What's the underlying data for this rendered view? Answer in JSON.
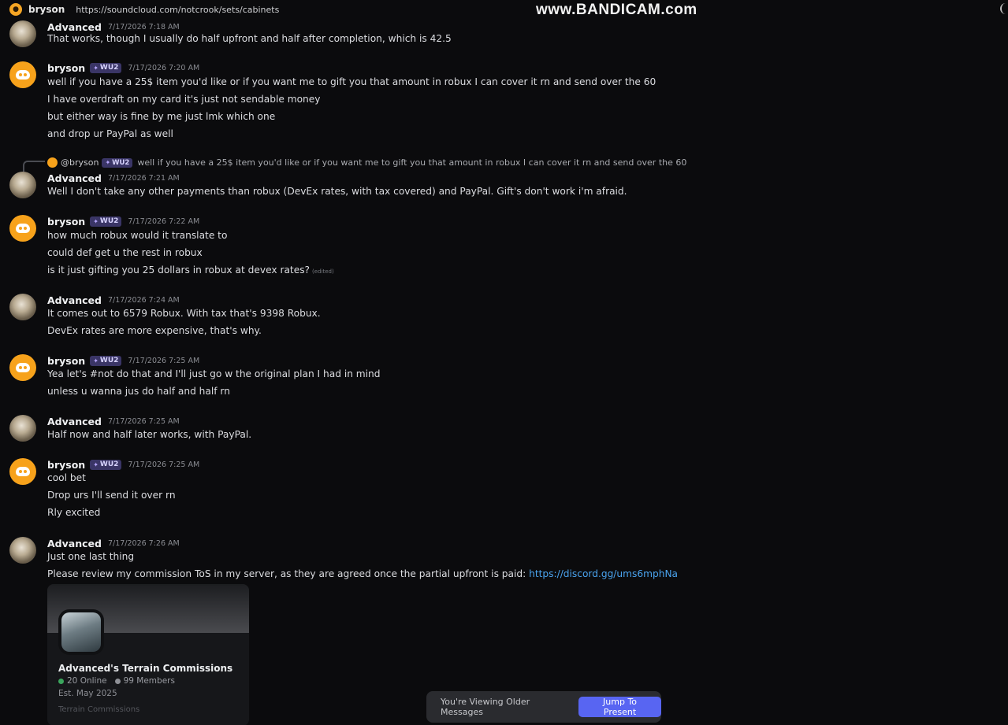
{
  "topbar": {
    "user": "bryson",
    "url": "https://soundcloud.com/notcrook/sets/cabinets",
    "watermark": "www.BANDICAM.com"
  },
  "messages": [
    {
      "author": "Advanced",
      "time": "7/17/2026 7:18 AM",
      "badge": "",
      "lines": [
        "That works, though I usually do half upfront and half after completion, which is 42.5"
      ]
    },
    {
      "author": "bryson",
      "time": "7/17/2026 7:20 AM",
      "badge": "WU2",
      "lines": [
        "well if you have a 25$ item you'd like or if you want me to gift you that amount in robux I can cover it rn and send over the 60",
        "I have overdraft on my card it's just not sendable money",
        "but either way is fine by me just lmk which one",
        "and drop ur PayPal as well"
      ]
    },
    {
      "author": "Advanced",
      "time": "7/17/2026 7:21 AM",
      "badge": "",
      "lines": [
        "Well I don't take any other payments than robux (DevEx rates, with tax covered) and PayPal. Gift's don't work i'm afraid."
      ]
    },
    {
      "author": "bryson",
      "time": "7/17/2026 7:22 AM",
      "badge": "WU2",
      "lines": [
        "how much robux would it translate to",
        "could def get u the rest in robux",
        "is it just gifting you 25 dollars in robux at devex rates?"
      ],
      "edited": "(edited)"
    },
    {
      "author": "Advanced",
      "time": "7/17/2026 7:24 AM",
      "badge": "",
      "lines": [
        "It comes out to 6579 Robux. With tax that's 9398 Robux.",
        "DevEx rates are more expensive, that's why."
      ]
    },
    {
      "author": "bryson",
      "time": "7/17/2026 7:25 AM",
      "badge": "WU2",
      "lines": [
        "Yea let's #not do that and I'll just go w the original plan I had in mind",
        "unless u wanna jus do half and half rn"
      ]
    },
    {
      "author": "Advanced",
      "time": "7/17/2026 7:25 AM",
      "badge": "",
      "lines": [
        "Half now and half later works, with PayPal."
      ]
    },
    {
      "author": "bryson",
      "time": "7/17/2026 7:25 AM",
      "badge": "WU2",
      "lines": [
        "cool bet",
        "Drop urs I'll send it over rn",
        "Rly excited"
      ]
    },
    {
      "author": "Advanced",
      "time": "7/17/2026 7:26 AM",
      "badge": "",
      "lines": [
        "Just one last thing",
        "Please review my commission ToS in my server, as they are agreed once the partial upfront is paid: "
      ],
      "link": "https://discord.gg/ums6mphNa"
    }
  ],
  "reply": {
    "user": "@bryson",
    "badge": "WU2",
    "text": "well if you have a 25$ item you'd like or if you want me to gift you that amount in robux I can cover it rn and send over the 60"
  },
  "invite": {
    "server_name": "Advanced's Terrain Commissions",
    "online": "20 Online",
    "members": "99 Members",
    "established": "Est. May 2025",
    "tag": "Terrain Commissions"
  },
  "jumpbar": {
    "older_text": "You're Viewing Older Messages",
    "jump_label": "Jump To Present"
  },
  "colors": {
    "background": "#0b0b0d",
    "accent": "#5865f2",
    "link": "#4aa3ee",
    "discord_avatar": "#f7a21b"
  }
}
